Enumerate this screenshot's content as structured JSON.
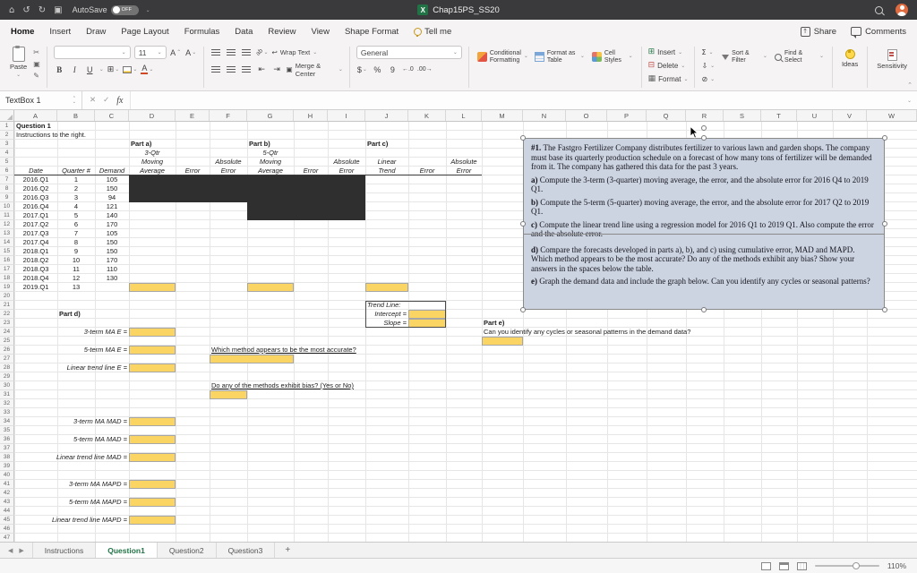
{
  "colors": {
    "highlight": "#FBD564",
    "dark_fill": "#2F2F2F",
    "textbox_bg": "#CCD3E1",
    "excel_green": "#217346"
  },
  "titlebar": {
    "autosave": "AutoSave",
    "autosave_state": "OFF",
    "title": "Chap15PS_SS20"
  },
  "tabs": {
    "items": [
      "Home",
      "Insert",
      "Draw",
      "Page Layout",
      "Formulas",
      "Data",
      "Review",
      "View",
      "Shape Format",
      "Tell me"
    ],
    "active": "Home",
    "share": "Share",
    "comments": "Comments"
  },
  "ribbon": {
    "paste": "Paste",
    "font_size": "11",
    "bold": "B",
    "italic": "I",
    "underline": "U",
    "wrap_text": "Wrap Text",
    "merge_center": "Merge & Center",
    "number_format": "General",
    "currency": "$",
    "percent": "%",
    "comma": "9",
    "dec_left": "←.0",
    "dec_right": ".00→",
    "cond_format": "Conditional Formatting",
    "format_table": "Format as Table",
    "cell_styles": "Cell Styles",
    "insert": "Insert",
    "del": "Delete",
    "format": "Format",
    "autosum": "Σ",
    "sort_filter": "Sort & Filter",
    "find_select": "Find & Select",
    "ideas": "Ideas",
    "sensitivity": "Sensitivity"
  },
  "formula_bar": {
    "name_box": "TextBox 1",
    "fx": "fx"
  },
  "sheet": {
    "columns": [
      "A",
      "B",
      "C",
      "D",
      "E",
      "F",
      "G",
      "H",
      "I",
      "J",
      "K",
      "L",
      "M",
      "N",
      "O",
      "P",
      "Q",
      "R",
      "S",
      "T",
      "U",
      "V",
      "W"
    ],
    "rows": 47,
    "demand_rows": [
      [
        "2016.Q1",
        "1",
        "105"
      ],
      [
        "2016.Q2",
        "2",
        "150"
      ],
      [
        "2016.Q3",
        "3",
        "94"
      ],
      [
        "2016.Q4",
        "4",
        "121"
      ],
      [
        "2017.Q1",
        "5",
        "140"
      ],
      [
        "2017.Q2",
        "6",
        "170"
      ],
      [
        "2017.Q3",
        "7",
        "105"
      ],
      [
        "2017.Q4",
        "8",
        "150"
      ],
      [
        "2018.Q1",
        "9",
        "150"
      ],
      [
        "2018.Q2",
        "10",
        "170"
      ],
      [
        "2018.Q3",
        "11",
        "110"
      ],
      [
        "2018.Q4",
        "12",
        "130"
      ],
      [
        "2019.Q1",
        "13",
        ""
      ]
    ],
    "cells": [
      {
        "c": "A",
        "r": 1,
        "t": "Question 1",
        "f": "b",
        "a": "l",
        "s": 2
      },
      {
        "c": "A",
        "r": 2,
        "t": "Instructions to the right.",
        "a": "l",
        "s": 3
      },
      {
        "c": "D",
        "r": 3,
        "t": "Part a)",
        "f": "b",
        "a": "l"
      },
      {
        "c": "G",
        "r": 3,
        "t": "Part b)",
        "f": "b",
        "a": "l"
      },
      {
        "c": "J",
        "r": 3,
        "t": "Part c)",
        "f": "b",
        "a": "l"
      },
      {
        "c": "D",
        "r": 4,
        "t": "3-Qtr",
        "f": "i",
        "a": "c"
      },
      {
        "c": "D",
        "r": 5,
        "t": "Moving",
        "f": "i",
        "a": "c"
      },
      {
        "c": "D",
        "r": 6,
        "t": "Average",
        "f": "i bb",
        "a": "c"
      },
      {
        "c": "E",
        "r": 6,
        "t": "Error",
        "f": "i bb",
        "a": "c"
      },
      {
        "c": "F",
        "r": 5,
        "t": "Absolute",
        "f": "i",
        "a": "c"
      },
      {
        "c": "F",
        "r": 6,
        "t": "Error",
        "f": "i bb",
        "a": "c"
      },
      {
        "c": "G",
        "r": 4,
        "t": "5-Qtr",
        "f": "i",
        "a": "c"
      },
      {
        "c": "G",
        "r": 5,
        "t": "Moving",
        "f": "i",
        "a": "c"
      },
      {
        "c": "G",
        "r": 6,
        "t": "Average",
        "f": "i bb",
        "a": "c"
      },
      {
        "c": "H",
        "r": 6,
        "t": "Error",
        "f": "i bb",
        "a": "c"
      },
      {
        "c": "I",
        "r": 5,
        "t": "Absolute",
        "f": "i",
        "a": "c"
      },
      {
        "c": "I",
        "r": 6,
        "t": "Error",
        "f": "i bb",
        "a": "c"
      },
      {
        "c": "J",
        "r": 5,
        "t": "Linear",
        "f": "i",
        "a": "c"
      },
      {
        "c": "J",
        "r": 6,
        "t": "Trend",
        "f": "i bb",
        "a": "c"
      },
      {
        "c": "K",
        "r": 6,
        "t": "Error",
        "f": "i bb",
        "a": "c"
      },
      {
        "c": "L",
        "r": 5,
        "t": "Absolute",
        "f": "i",
        "a": "c"
      },
      {
        "c": "L",
        "r": 6,
        "t": "Error",
        "f": "i bb",
        "a": "c"
      },
      {
        "c": "A",
        "r": 6,
        "t": "Date",
        "f": "i bb",
        "a": "c"
      },
      {
        "c": "B",
        "r": 6,
        "t": "Quarter #",
        "f": "i bb",
        "a": "c"
      },
      {
        "c": "C",
        "r": 6,
        "t": "Demand",
        "f": "i bb",
        "a": "c"
      },
      {
        "c": "B",
        "r": 22,
        "t": "Part d)",
        "f": "b",
        "a": "l"
      },
      {
        "c": "A",
        "r": 24,
        "t": "3-term MA E =",
        "f": "i",
        "a": "r",
        "s": 3
      },
      {
        "c": "A",
        "r": 26,
        "t": "5-term MA E =",
        "f": "i",
        "a": "r",
        "s": 3
      },
      {
        "c": "A",
        "r": 28,
        "t": "Linear trend line E =",
        "f": "i",
        "a": "r",
        "s": 3
      },
      {
        "c": "A",
        "r": 34,
        "t": "3-term MA MAD =",
        "f": "i",
        "a": "r",
        "s": 3
      },
      {
        "c": "A",
        "r": 36,
        "t": "5-term MA MAD =",
        "f": "i",
        "a": "r",
        "s": 3
      },
      {
        "c": "A",
        "r": 38,
        "t": "Linear trend line MAD =",
        "f": "i",
        "a": "r",
        "s": 3
      },
      {
        "c": "A",
        "r": 41,
        "t": "3-term MA MAPD =",
        "f": "i",
        "a": "r",
        "s": 3
      },
      {
        "c": "A",
        "r": 43,
        "t": "5-term MA MAPD =",
        "f": "i",
        "a": "r",
        "s": 3
      },
      {
        "c": "A",
        "r": 45,
        "t": "Linear trend line MAPD =",
        "f": "i",
        "a": "r",
        "s": 3
      },
      {
        "c": "F",
        "r": 26,
        "t": "Which method appears to be the most accurate?",
        "f": "u",
        "a": "l",
        "s": 6
      },
      {
        "c": "F",
        "r": 30,
        "t": "Do any of the methods exhibit bias? (Yes or No)",
        "f": "u",
        "a": "l",
        "s": 6
      },
      {
        "c": "J",
        "r": 21,
        "t": "Trend Line:",
        "f": "i",
        "a": "l",
        "s": 2
      },
      {
        "c": "J",
        "r": 22,
        "t": "Intercept =",
        "f": "i",
        "a": "r"
      },
      {
        "c": "J",
        "r": 23,
        "t": "Slope =",
        "f": "i",
        "a": "r"
      },
      {
        "c": "M",
        "r": 23,
        "t": "Part e)",
        "f": "b",
        "a": "l"
      },
      {
        "c": "M",
        "r": 24,
        "t": "Can you identify any cycles or seasonal patterns in the demand data?",
        "a": "l",
        "s": 8
      }
    ],
    "dark_blocks": [
      {
        "c1": "D",
        "r1": 7,
        "c2": "F",
        "r2": 9
      },
      {
        "c1": "G",
        "r1": 7,
        "c2": "I",
        "r2": 11
      }
    ],
    "answer_cells": [
      {
        "c": "D",
        "r": 19
      },
      {
        "c": "G",
        "r": 19
      },
      {
        "c": "J",
        "r": 19
      },
      {
        "c": "K",
        "r": 22
      },
      {
        "c": "K",
        "r": 23
      },
      {
        "c": "D",
        "r": 24
      },
      {
        "c": "D",
        "r": 26
      },
      {
        "c": "D",
        "r": 28
      },
      {
        "c": "F",
        "r": 27,
        "s": 2
      },
      {
        "c": "F",
        "r": 31
      },
      {
        "c": "D",
        "r": 34
      },
      {
        "c": "D",
        "r": 36
      },
      {
        "c": "D",
        "r": 38
      },
      {
        "c": "D",
        "r": 41
      },
      {
        "c": "D",
        "r": 43
      },
      {
        "c": "D",
        "r": 45
      },
      {
        "c": "M",
        "r": 25
      }
    ],
    "trend_box": {
      "c1": "J",
      "r1": 21,
      "c2": "K",
      "r2": 23
    }
  },
  "textbox": {
    "paragraphs": [
      {
        "lead": "#1.",
        "text": "The Fastgro Fertilizer Company distributes fertilizer to various lawn and garden shops. The company must base its quarterly production schedule on a forecast of how many tons of fertilizer will be demanded from it. The company has gathered this data for the past 3 years."
      },
      {
        "lead": "a)",
        "text": "Compute the 3-term (3-quarter) moving average, the error, and the absolute error for 2016 Q4 to 2019 Q1."
      },
      {
        "lead": "b)",
        "text": "Compute the 5-term (5-quarter) moving average, the error, and the absolute error for 2017 Q2 to 2019 Q1."
      },
      {
        "lead": "c)",
        "text": "Compute the linear trend line using a regression model for 2016 Q1 to 2019 Q1. Also compute the error and the absolute error."
      },
      {
        "lead": "d)",
        "text": "Compare the forecasts developed in parts a), b), and c) using cumulative error, MAD and MAPD. Which method appears to be the most accurate? Do any of the methods exhibit any bias? Show your answers in the spaces below the table."
      },
      {
        "lead": "e)",
        "text": "Graph the demand data and include the graph below. Can you identify any cycles or seasonal patterns?"
      }
    ]
  },
  "sheet_tabs": {
    "items": [
      "Instructions",
      "Question1",
      "Question2",
      "Question3"
    ],
    "active": "Question1",
    "add": "+"
  },
  "statusbar": {
    "zoom": "110%"
  }
}
